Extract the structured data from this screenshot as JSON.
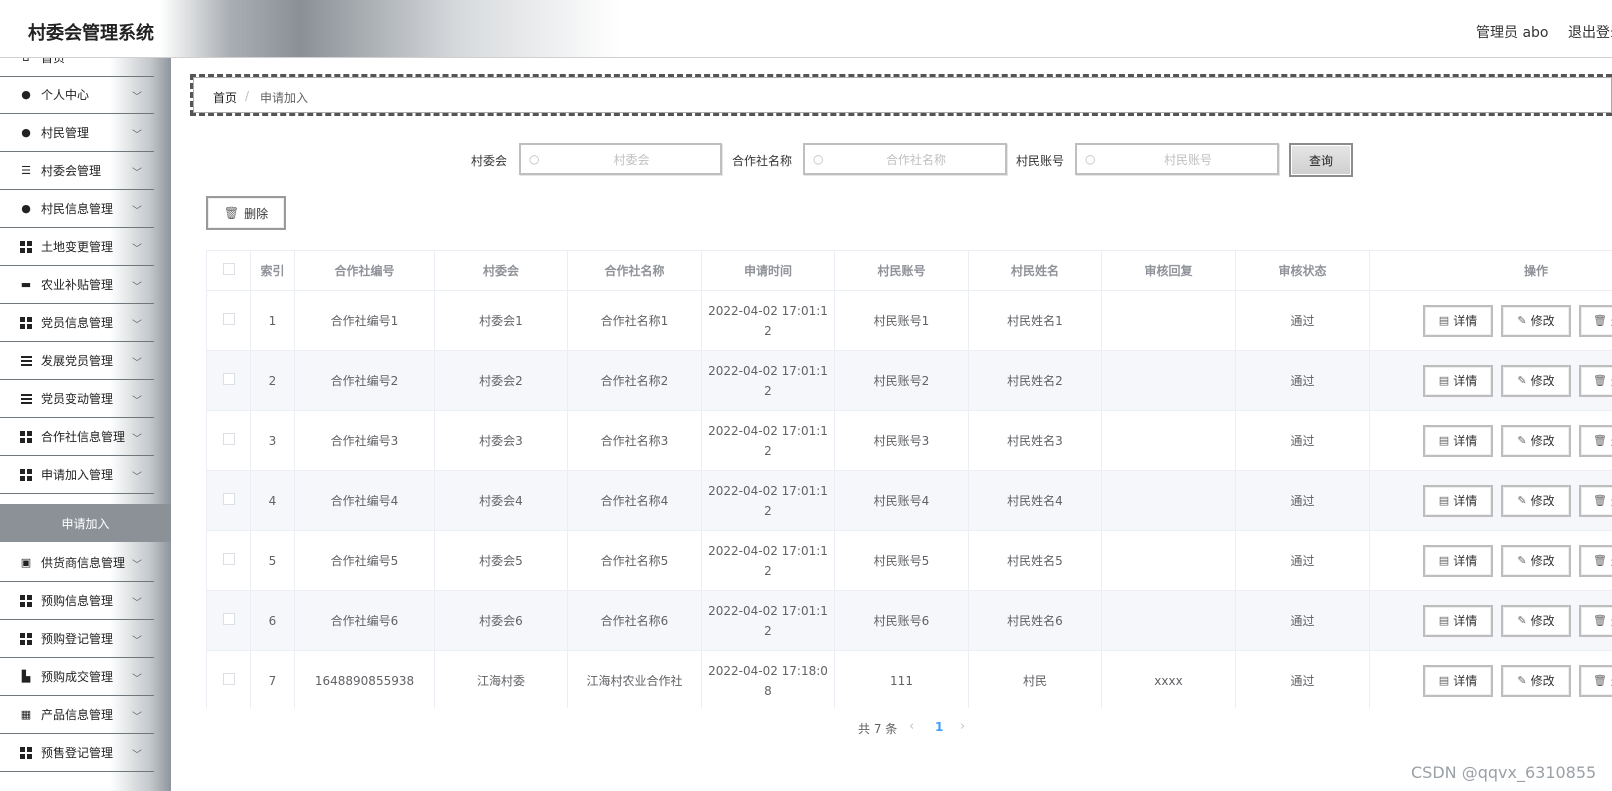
{
  "header": {
    "title": "村委会管理系统",
    "admin": "管理员 abo",
    "logout": "退出登录"
  },
  "sidebar": {
    "top_partial": "首页",
    "items": [
      {
        "label": "个人中心",
        "icon": "user-icon"
      },
      {
        "label": "村民管理",
        "icon": "location-icon"
      },
      {
        "label": "村委会管理",
        "icon": "sliders-icon"
      },
      {
        "label": "村民信息管理",
        "icon": "user-icon"
      },
      {
        "label": "土地变更管理",
        "icon": "grid-icon"
      },
      {
        "label": "农业补贴管理",
        "icon": "briefcase-icon"
      },
      {
        "label": "党员信息管理",
        "icon": "grid-icon"
      },
      {
        "label": "发展党员管理",
        "icon": "list-icon"
      },
      {
        "label": "党员变动管理",
        "icon": "list-icon"
      },
      {
        "label": "合作社信息管理",
        "icon": "grid-icon"
      },
      {
        "label": "申请加入管理",
        "icon": "grid-icon"
      }
    ],
    "active_sub": "申请加入",
    "items_after": [
      {
        "label": "供货商信息管理",
        "icon": "clipboard-icon"
      },
      {
        "label": "预购信息管理",
        "icon": "grid-icon"
      },
      {
        "label": "预购登记管理",
        "icon": "grid-icon"
      },
      {
        "label": "预购成交管理",
        "icon": "wallet-icon"
      },
      {
        "label": "产品信息管理",
        "icon": "grid9-icon"
      },
      {
        "label": "预售登记管理",
        "icon": "grid-icon"
      }
    ]
  },
  "breadcrumb": {
    "home": "首页",
    "separator": "/",
    "current": "申请加入"
  },
  "search": {
    "village_label": "村委会",
    "village_placeholder": "村委会",
    "coop_label": "合作社名称",
    "coop_placeholder": "合作社名称",
    "account_label": "村民账号",
    "account_placeholder": "村民账号",
    "query_button": "查询"
  },
  "toolbar": {
    "delete_label": "删除"
  },
  "table": {
    "columns": [
      "索引",
      "合作社编号",
      "村委会",
      "合作社名称",
      "申请时间",
      "村民账号",
      "村民姓名",
      "审核回复",
      "审核状态",
      "操作"
    ],
    "rows": [
      {
        "index": "1",
        "coop_no": "合作社编号1",
        "village": "村委会1",
        "coop_name": "合作社名称1",
        "time_a": "2022-04-02 17:01:1",
        "time_b": "2",
        "account": "村民账号1",
        "name": "村民姓名1",
        "reply": "",
        "status": "通过"
      },
      {
        "index": "2",
        "coop_no": "合作社编号2",
        "village": "村委会2",
        "coop_name": "合作社名称2",
        "time_a": "2022-04-02 17:01:1",
        "time_b": "2",
        "account": "村民账号2",
        "name": "村民姓名2",
        "reply": "",
        "status": "通过"
      },
      {
        "index": "3",
        "coop_no": "合作社编号3",
        "village": "村委会3",
        "coop_name": "合作社名称3",
        "time_a": "2022-04-02 17:01:1",
        "time_b": "2",
        "account": "村民账号3",
        "name": "村民姓名3",
        "reply": "",
        "status": "通过"
      },
      {
        "index": "4",
        "coop_no": "合作社编号4",
        "village": "村委会4",
        "coop_name": "合作社名称4",
        "time_a": "2022-04-02 17:01:1",
        "time_b": "2",
        "account": "村民账号4",
        "name": "村民姓名4",
        "reply": "",
        "status": "通过"
      },
      {
        "index": "5",
        "coop_no": "合作社编号5",
        "village": "村委会5",
        "coop_name": "合作社名称5",
        "time_a": "2022-04-02 17:01:1",
        "time_b": "2",
        "account": "村民账号5",
        "name": "村民姓名5",
        "reply": "",
        "status": "通过"
      },
      {
        "index": "6",
        "coop_no": "合作社编号6",
        "village": "村委会6",
        "coop_name": "合作社名称6",
        "time_a": "2022-04-02 17:01:1",
        "time_b": "2",
        "account": "村民账号6",
        "name": "村民姓名6",
        "reply": "",
        "status": "通过"
      },
      {
        "index": "7",
        "coop_no": "1648890855938",
        "village": "江海村委",
        "coop_name": "江海村农业合作社",
        "time_a": "2022-04-02 17:18:0",
        "time_b": "8",
        "account": "111",
        "name": "村民",
        "reply": "xxxx",
        "status": "通过"
      }
    ],
    "actions": {
      "detail": "详情",
      "edit": "修改",
      "delete": "删除"
    }
  },
  "pagination": {
    "total": "共 7 条",
    "current_page": "1",
    "prev": "‹",
    "next": "›"
  },
  "watermark": "CSDN @qqvx_6310855",
  "colors": {
    "accent": "#409eff",
    "sidebar_active": "#8b9197"
  }
}
